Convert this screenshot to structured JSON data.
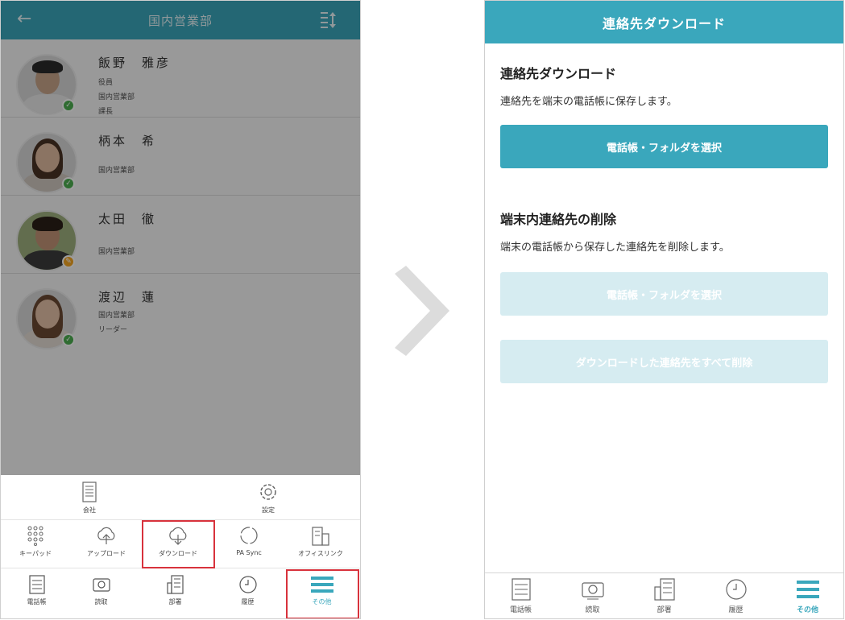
{
  "left_screen": {
    "header": {
      "title": "国内営業部",
      "back_icon": "back-arrow-icon",
      "sort_icon": "sort-icon"
    },
    "contacts": [
      {
        "name": "飯野　雅彦",
        "lines": [
          "役員",
          "国内営業部",
          "課長"
        ],
        "status": "available",
        "status_color": "#4caf50"
      },
      {
        "name": "柄本　希",
        "lines": [
          "国内営業部"
        ],
        "status": "available",
        "status_color": "#4caf50"
      },
      {
        "name": "太田　徹",
        "lines": [
          "国内営業部"
        ],
        "status": "busy",
        "status_color": "#f5a623"
      },
      {
        "name": "渡辺　蓮",
        "lines": [
          "国内営業部",
          "リーダー"
        ],
        "status": "available",
        "status_color": "#4caf50"
      }
    ],
    "menu_row1": [
      {
        "label": "会社",
        "icon": "company-icon"
      },
      {
        "label": "設定",
        "icon": "gear-icon"
      }
    ],
    "menu_row2": [
      {
        "label": "キーパッド",
        "icon": "keypad-icon"
      },
      {
        "label": "アップロード",
        "icon": "cloud-upload-icon"
      },
      {
        "label": "ダウンロード",
        "icon": "cloud-download-icon"
      },
      {
        "label": "PA Sync",
        "icon": "sync-icon"
      },
      {
        "label": "オフィスリンク",
        "icon": "office-link-icon"
      }
    ],
    "bottom_nav": [
      {
        "label": "電話帳",
        "icon": "phonebook-icon"
      },
      {
        "label": "読取",
        "icon": "camera-icon"
      },
      {
        "label": "部署",
        "icon": "building-icon"
      },
      {
        "label": "履歴",
        "icon": "clock-icon"
      },
      {
        "label": "その他",
        "icon": "menu-icon",
        "active": true
      }
    ]
  },
  "right_screen": {
    "header": {
      "title": "連絡先ダウンロード"
    },
    "section1": {
      "title": "連絡先ダウンロード",
      "description": "連絡先を端末の電話帳に保存します。",
      "button": "電話帳・フォルダを選択"
    },
    "section2": {
      "title": "端末内連絡先の削除",
      "description": "端末の電話帳から保存した連絡先を削除します。",
      "button1": "電話帳・フォルダを選択",
      "button2": "ダウンロードした連絡先をすべて削除"
    },
    "bottom_nav": [
      {
        "label": "電話帳",
        "icon": "phonebook-icon"
      },
      {
        "label": "読取",
        "icon": "camera-icon"
      },
      {
        "label": "部署",
        "icon": "building-icon"
      },
      {
        "label": "履歴",
        "icon": "clock-icon"
      },
      {
        "label": "その他",
        "icon": "menu-icon",
        "active": true
      }
    ]
  },
  "colors": {
    "accent": "#3aa7bc",
    "highlight": "#d8323c",
    "disabled_button": "#d6ecf1"
  }
}
